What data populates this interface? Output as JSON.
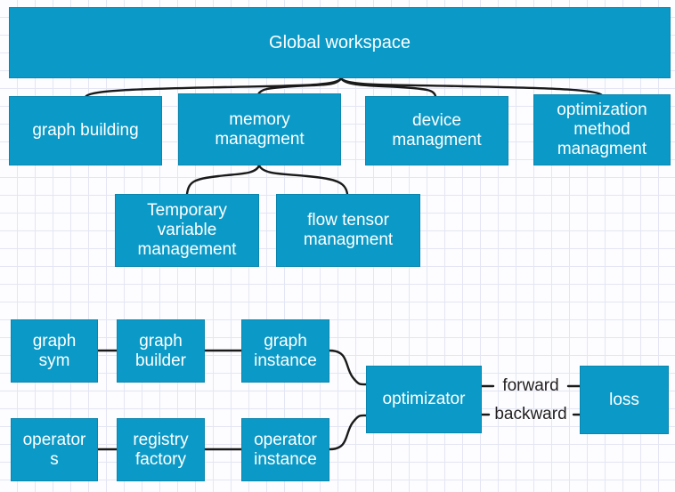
{
  "diagram": {
    "title_box": {
      "label": "Global workspace"
    },
    "layer2": [
      {
        "key": "graph_building",
        "label": "graph building"
      },
      {
        "key": "memory_managment",
        "label": "memory\nmanagment"
      },
      {
        "key": "device_managment",
        "label": "device\nmanagment"
      },
      {
        "key": "optimization_method_managment",
        "label": "optimization\nmethod\nmanagment"
      }
    ],
    "layer3": [
      {
        "key": "temporary_variable_management",
        "label": "Temporary\nvariable\nmanagement"
      },
      {
        "key": "flow_tensor_managment",
        "label": "flow tensor\nmanagment"
      }
    ],
    "pipeline": {
      "top_row": [
        {
          "key": "graph_sym",
          "label": "graph\nsym"
        },
        {
          "key": "graph_builder",
          "label": "graph\nbuilder"
        },
        {
          "key": "graph_instance",
          "label": "graph\ninstance"
        }
      ],
      "bottom_row": [
        {
          "key": "operators",
          "label": "operator\ns"
        },
        {
          "key": "registry_factory",
          "label": "registry\nfactory"
        },
        {
          "key": "operator_instance",
          "label": "operator\ninstance"
        }
      ],
      "optimizator": {
        "label": "optimizator"
      },
      "loss": {
        "label": "loss"
      },
      "edge_labels": [
        {
          "key": "forward",
          "label": "forward"
        },
        {
          "key": "backward",
          "label": "backward"
        }
      ]
    },
    "colors": {
      "node_fill": "#0b9ac7",
      "node_border": "#0a86ae",
      "node_text": "#ffffff",
      "connector": "#1a1a1a",
      "grid_line": "#e3e6f3",
      "background": "#fdfdff",
      "label_text": "#231f20"
    }
  }
}
